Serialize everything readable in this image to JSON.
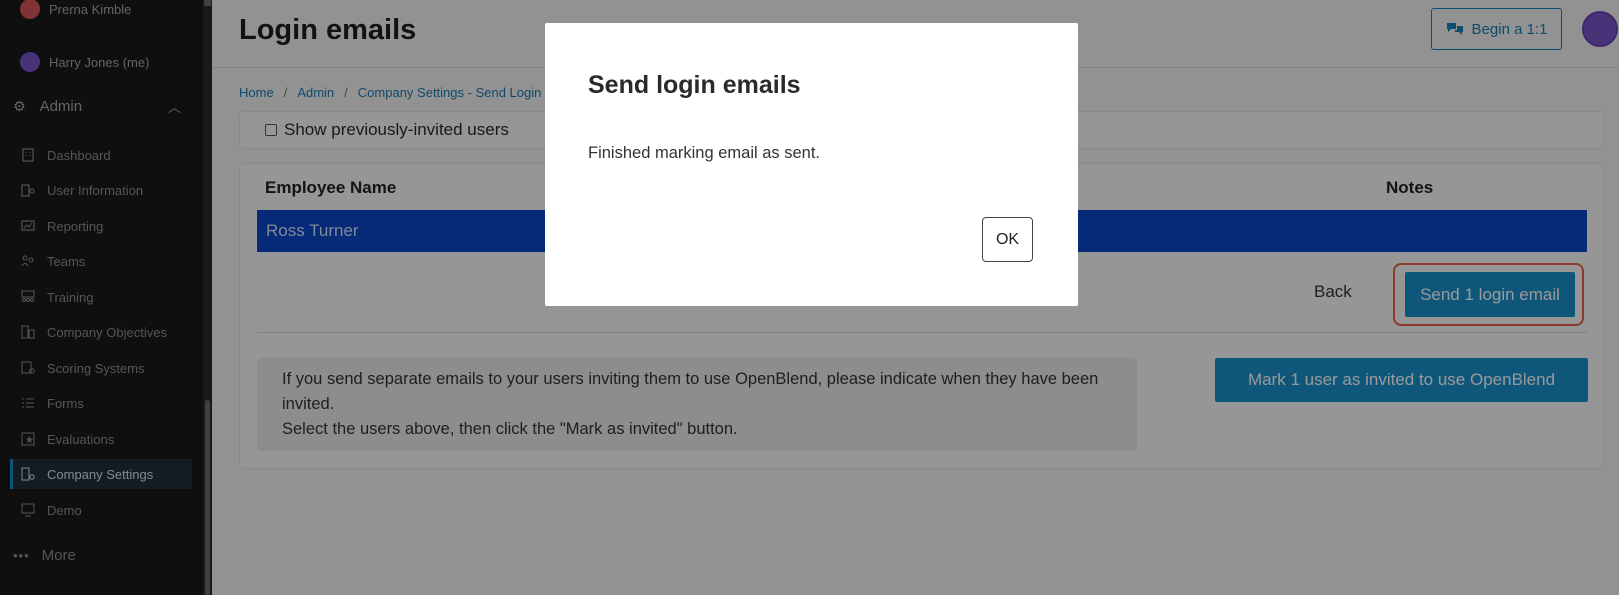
{
  "sidebar": {
    "users": [
      {
        "name": "Prerna Kimble",
        "color": "#d9545a"
      },
      {
        "name": "Harry Jones (me)",
        "color": "#7b56c9"
      }
    ],
    "section_label": "Admin",
    "items": [
      {
        "label": "Dashboard",
        "icon": "building-icon"
      },
      {
        "label": "User Information",
        "icon": "user-info-icon"
      },
      {
        "label": "Reporting",
        "icon": "chart-icon"
      },
      {
        "label": "Teams",
        "icon": "teams-icon"
      },
      {
        "label": "Training",
        "icon": "training-icon"
      },
      {
        "label": "Company Objectives",
        "icon": "objectives-icon"
      },
      {
        "label": "Scoring Systems",
        "icon": "scoring-icon"
      },
      {
        "label": "Forms",
        "icon": "forms-icon"
      },
      {
        "label": "Evaluations",
        "icon": "evaluations-icon"
      },
      {
        "label": "Company Settings",
        "icon": "settings-icon",
        "active": true
      },
      {
        "label": "Demo",
        "icon": "demo-icon"
      }
    ],
    "more_label": "More"
  },
  "header": {
    "title": "Login emails",
    "begin_label": "Begin a 1:1"
  },
  "breadcrumb": [
    "Home",
    "Admin",
    "Company Settings - Send Login"
  ],
  "filter": {
    "show_previous_label": "Show previously-invited users",
    "checked": false
  },
  "table": {
    "columns": [
      "Employee Name",
      "Notes"
    ],
    "rows": [
      {
        "name": "Ross Turner",
        "selected": true
      }
    ]
  },
  "actions": {
    "back_label": "Back",
    "send_label": "Send 1 login email",
    "mark_label": "Mark 1 user as invited to use OpenBlend"
  },
  "info": {
    "line1": "If you send separate emails to your users inviting them to use OpenBlend, please indicate when they have been invited.",
    "line2": "Select the users above, then click the \"Mark as invited\" button."
  },
  "modal": {
    "title": "Send login emails",
    "message": "Finished marking email as sent.",
    "ok_label": "OK"
  },
  "colors": {
    "accent": "#1a91cc",
    "selected_row": "#0b47c9",
    "highlight": "#e8634a",
    "sidebar_bg": "#1a1a1c"
  }
}
